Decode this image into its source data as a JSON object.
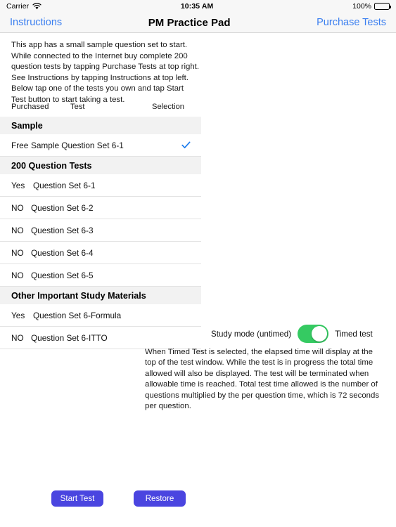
{
  "status_bar": {
    "carrier": "Carrier",
    "wifi_icon": "wifi-icon",
    "time": "10:35 AM",
    "battery_percent": "100%",
    "battery_icon": "battery-full-icon"
  },
  "nav_bar": {
    "left_button": "Instructions",
    "title": "PM Practice Pad",
    "right_button": "Purchase Tests"
  },
  "intro_text": "This app has a small sample question set to start. While connected to the Internet buy complete 200 question tests by tapping Purchase Tests at top right. See Instructions by tapping Instructions at top left. Below tap one of the tests you own and tap Start Test button to start taking a test.",
  "table": {
    "columns": [
      "Purchased",
      "Test",
      "Selection"
    ],
    "sections": [
      {
        "title": "Sample",
        "rows": [
          {
            "purchased": "Free",
            "test": "Sample Question Set 6-1",
            "selected": true
          }
        ]
      },
      {
        "title": "200 Question Tests",
        "rows": [
          {
            "purchased": "Yes",
            "test": "Question Set 6-1",
            "selected": false
          },
          {
            "purchased": "NO",
            "test": "Question Set 6-2",
            "selected": false
          },
          {
            "purchased": "NO",
            "test": "Question Set 6-3",
            "selected": false
          },
          {
            "purchased": "NO",
            "test": "Question Set 6-4",
            "selected": false
          },
          {
            "purchased": "NO",
            "test": "Question Set 6-5",
            "selected": false
          }
        ]
      },
      {
        "title": "Other Important Study Materials",
        "rows": [
          {
            "purchased": "Yes",
            "test": "Question Set 6-Formula",
            "selected": false
          },
          {
            "purchased": "NO",
            "test": "Question Set 6-ITTO",
            "selected": false
          }
        ]
      }
    ],
    "checkmark_color": "#1c7ced"
  },
  "mode_toggle": {
    "left_label": "Study mode (untimed)",
    "right_label": "Timed test",
    "state": "on",
    "on_color": "#35ca62"
  },
  "timed_note": "When Timed Test is selected, the elapsed time will display at the top of the test window. While the test is in progress the total time allowed will also be displayed. The test will be terminated when allowable time is reached. Total test time allowed is the number of questions multiplied by the per question time, which is 72 seconds per question.",
  "buttons": {
    "start_test": "Start Test",
    "restore": "Restore",
    "color": "#4a45e0"
  }
}
